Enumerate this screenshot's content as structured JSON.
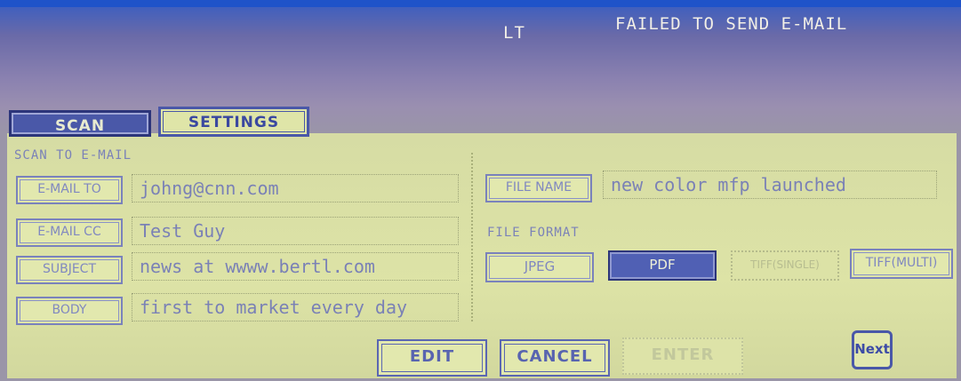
{
  "header": {
    "paper_size": "LT",
    "status_message": "FAILED TO SEND E-MAIL"
  },
  "tabs": [
    {
      "label": "SCAN",
      "active": true
    },
    {
      "label": "SETTINGS",
      "active": false
    }
  ],
  "section_label": "SCAN TO E-MAIL",
  "email_fields": [
    {
      "button_label": "E-MAIL TO",
      "value": "johng@cnn.com"
    },
    {
      "button_label": "E-MAIL CC",
      "value": "Test Guy"
    },
    {
      "button_label": "SUBJECT",
      "value": "news at wwww.bertl.com"
    },
    {
      "button_label": "BODY",
      "value": "first to market every day"
    }
  ],
  "file_name": {
    "button_label": "FILE NAME",
    "value": "new color mfp launched"
  },
  "file_format": {
    "label": "FILE FORMAT",
    "options": [
      {
        "label": "JPEG",
        "state": "normal"
      },
      {
        "label": "PDF",
        "state": "selected"
      },
      {
        "label": "TIFF(SINGLE)",
        "state": "disabled"
      },
      {
        "label": "TIFF(MULTI)",
        "state": "normal"
      }
    ],
    "selected": "PDF"
  },
  "actions": {
    "edit_label": "EDIT",
    "cancel_label": "CANCEL",
    "enter_label": "ENTER",
    "next_label": "Next"
  },
  "colors": {
    "panel_background": "#dde3a6",
    "accent_blue": "#4a58a8",
    "header_background": "#8b82b0"
  }
}
